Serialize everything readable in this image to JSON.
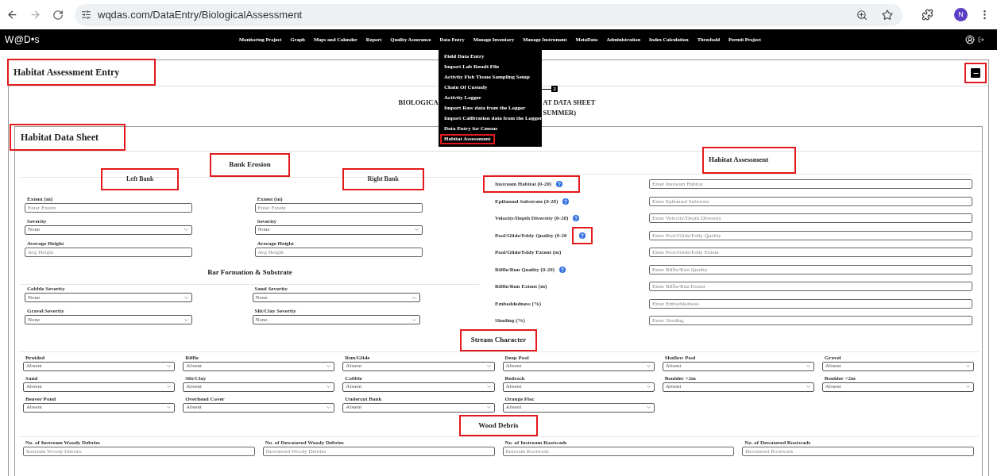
{
  "browser": {
    "url": "wqdas.com/DataEntry/BiologicalAssessment",
    "profile_initial": "N"
  },
  "navbar": {
    "logo": "W@D•s",
    "items": [
      "Monitoring Project",
      "Graph",
      "Maps and Calender",
      "Report",
      "Quality Assurance",
      "Data Entry",
      "Manage Inventory",
      "Manage Instrument",
      "MetaData",
      "Administration",
      "Index Calculation",
      "Threshold",
      "Permit Project"
    ],
    "dropdown": [
      {
        "label": "Field Data Entry",
        "highlighted": false
      },
      {
        "label": "Import Lab Result File",
        "highlighted": false
      },
      {
        "label": "Activity Fish Tissue Sampling Setup",
        "highlighted": false
      },
      {
        "label": "Chain Of Custody",
        "highlighted": false
      },
      {
        "label": "Activity Logger",
        "highlighted": false
      },
      {
        "label": "Import Raw data from the Logger",
        "highlighted": false
      },
      {
        "label": "Import Calibration data from the Logger",
        "highlighted": false
      },
      {
        "label": "Data Entry for Census",
        "highlighted": false
      },
      {
        "label": "Habitat Assessment",
        "highlighted": true
      }
    ],
    "annotation_marker": "2"
  },
  "entry_card": {
    "title": "Habitat Assessment Entry",
    "highlighted": true,
    "collapse_highlighted": true
  },
  "sheet_title": {
    "line_1_left": "BIOLOGICA",
    "line_1_right": "AT DATA SHEET",
    "line_2_right": "SUMMER)"
  },
  "data_sheet": {
    "title": "Habitat Data Sheet",
    "highlighted": true
  },
  "bank_erosion": {
    "title": "Bank Erosion",
    "highlighted": true,
    "banks": [
      {
        "title": "Left Bank",
        "highlighted": true,
        "fields": [
          {
            "kind": "input",
            "label": "Extent (m)",
            "placeholder": "Enter Extent"
          },
          {
            "kind": "select",
            "label": "Severity",
            "value": "None"
          },
          {
            "kind": "input",
            "label": "Average Height",
            "placeholder": "Avg Height"
          }
        ]
      },
      {
        "title": "Right Bank",
        "highlighted": true,
        "fields": [
          {
            "kind": "input",
            "label": "Extent (m)",
            "placeholder": "Enter Extent"
          },
          {
            "kind": "select",
            "label": "Severity",
            "value": "None"
          },
          {
            "kind": "input",
            "label": "Average Height",
            "placeholder": "Avg Height"
          }
        ]
      }
    ]
  },
  "bar_formation": {
    "title": "Bar Formation & Substrate",
    "highlighted": false,
    "fields": [
      {
        "kind": "select",
        "label": "Cobble Severity",
        "value": "None"
      },
      {
        "kind": "select",
        "label": "Sand Severity",
        "value": "None"
      },
      {
        "kind": "select",
        "label": "Gravel Severity",
        "value": "None"
      },
      {
        "kind": "select",
        "label": "Slit/Clay Severity",
        "value": "None"
      }
    ]
  },
  "habitat_assessment": {
    "title": "Habitat Assessment",
    "highlighted": true,
    "rows": [
      {
        "label": "Instream Habitat (0-20)",
        "help": true,
        "label_highlighted": true,
        "help_highlighted": false,
        "placeholder": "Enter Instream Habitat"
      },
      {
        "label": "Epifaunal Substrate (0-20)",
        "help": true,
        "label_highlighted": false,
        "help_highlighted": false,
        "placeholder": "Enter Epifaunal Substrate"
      },
      {
        "label": "Velocity/Depth Diversity (0-20)",
        "help": true,
        "label_highlighted": false,
        "help_highlighted": false,
        "placeholder": "Enter Velocity/Depth Diversity"
      },
      {
        "label": "Pool/Glide/Eddy Quality (0-20",
        "help": true,
        "label_highlighted": false,
        "help_highlighted": true,
        "placeholder": "Enter Pool/Glide/Eddy Quality"
      },
      {
        "label": "Pool/Glide/Eddy Extent (m)",
        "help": false,
        "label_highlighted": false,
        "help_highlighted": false,
        "placeholder": "Enter Pool/Glide/Eddy Extent"
      },
      {
        "label": "Riffle/Run Quality (0-20)",
        "help": true,
        "label_highlighted": false,
        "help_highlighted": false,
        "placeholder": "Enter Riffle/Run Quality"
      },
      {
        "label": "Riffle/Run Extent (m)",
        "help": false,
        "label_highlighted": false,
        "help_highlighted": false,
        "placeholder": "Enter Riffle/Run Extent"
      },
      {
        "label": "Embeddedness (%)",
        "help": false,
        "label_highlighted": false,
        "help_highlighted": false,
        "placeholder": "Enter Embeddedness"
      },
      {
        "label": "Shading (%)",
        "help": false,
        "label_highlighted": false,
        "help_highlighted": false,
        "placeholder": "Enter Shading"
      }
    ]
  },
  "stream_character": {
    "title": "Stream Character",
    "highlighted": true,
    "fields": [
      {
        "kind": "select",
        "label": "Braided",
        "value": "Absent"
      },
      {
        "kind": "select",
        "label": "Riffle",
        "value": "Absent"
      },
      {
        "kind": "select",
        "label": "Run/Glide",
        "value": "Absent"
      },
      {
        "kind": "select",
        "label": "Deep Pool",
        "value": "Absent"
      },
      {
        "kind": "select",
        "label": "Shallow Pool",
        "value": "Absent"
      },
      {
        "kind": "select",
        "label": "Gravel",
        "value": "Absent"
      },
      {
        "kind": "select",
        "label": "Sand",
        "value": "Absent"
      },
      {
        "kind": "select",
        "label": "Slit/Clay",
        "value": "Absent"
      },
      {
        "kind": "select",
        "label": "Cobble",
        "value": "Absent"
      },
      {
        "kind": "select",
        "label": "Bedrock",
        "value": "Absent"
      },
      {
        "kind": "select",
        "label": "Boulder >2m",
        "value": "Absent"
      },
      {
        "kind": "select",
        "label": "Boulder <2m",
        "value": "Absent"
      },
      {
        "kind": "select",
        "label": "Beaver Pond",
        "value": "Absent"
      },
      {
        "kind": "select",
        "label": "Overhead Cover",
        "value": "Absent"
      },
      {
        "kind": "select",
        "label": "Undercut Bank",
        "value": "Absent"
      },
      {
        "kind": "select",
        "label": "Orange Floc",
        "value": "Absent"
      }
    ]
  },
  "wood_debris": {
    "title": "Wood Debris",
    "highlighted": true,
    "fields": [
      {
        "kind": "input",
        "label": "No. of Instream Woody Debries",
        "placeholder": "Instream Woody Debries"
      },
      {
        "kind": "input",
        "label": "No. of Dewatered Woody Debries",
        "placeholder": "Dewatered Woody Debries"
      },
      {
        "kind": "input",
        "label": "No. of Instream Rootwads",
        "placeholder": "Instream Rootwads"
      },
      {
        "kind": "input",
        "label": "No. of Dewatered Rootwads",
        "placeholder": "Dewatered Rootwads"
      }
    ]
  }
}
